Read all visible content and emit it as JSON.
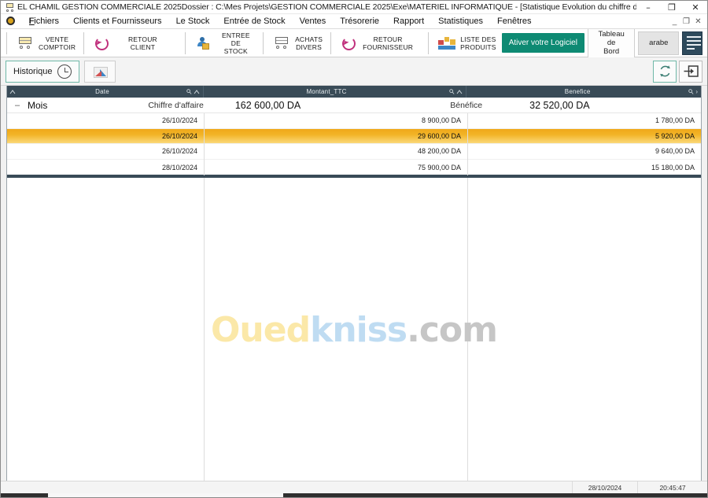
{
  "window": {
    "title": "EL CHAMIL GESTION COMMERCIALE 2025Dossier : C:\\Mes Projets\\GESTION COMMERCIALE 2025\\Exe\\MATERIEL INFORMATIQUE - [Statistique Evolution du chiffre d'Affaire]",
    "minimize": "–",
    "maximize": "❐",
    "close": "✕",
    "mdi_minimize": "_",
    "mdi_restore": "❐",
    "mdi_close": "✕"
  },
  "menubar": {
    "items": [
      {
        "label": "Fichiers",
        "accel": "F"
      },
      {
        "label": "Clients et Fournisseurs",
        "accel": "C"
      },
      {
        "label": "Le Stock",
        "accel": "S"
      },
      {
        "label": "Entrée de Stock",
        "accel": "E"
      },
      {
        "label": "Ventes",
        "accel": "V"
      },
      {
        "label": "Trésorerie",
        "accel": "T"
      },
      {
        "label": "Rapport",
        "accel": "R"
      },
      {
        "label": "Statistiques",
        "accel": "S"
      },
      {
        "label": "Fenêtres",
        "accel": "F"
      }
    ]
  },
  "ribbon": {
    "buttons": [
      {
        "label": "VENTE\nCOMPTOIR",
        "icon": "shopping-cart-icon"
      },
      {
        "label": "RETOUR CLIENT",
        "icon": "return-arrow-icon"
      },
      {
        "label": "ENTREE DE\nSTOCK",
        "icon": "person-box-icon"
      },
      {
        "label": "ACHATS\nDIVERS",
        "icon": "shopping-cart-icon"
      },
      {
        "label": "RETOUR\nFOURNISSEUR",
        "icon": "return-arrow-icon"
      },
      {
        "label": "LISTE DES\nPRODUITS",
        "icon": "product-boxes-icon"
      }
    ],
    "activate_label": "Ativer votre Logiciel",
    "dashboard_label": "Tableau de\nBord",
    "language_label": "arabe",
    "menu_icon": "hamburger-menu-icon"
  },
  "subbar": {
    "historique_label": "Historique",
    "historique_icon": "clock-icon",
    "chart_icon": "chart-icon",
    "refresh_icon": "refresh-icon",
    "exit_icon": "exit-icon"
  },
  "grid": {
    "columns": [
      {
        "key": "date",
        "header": "Date"
      },
      {
        "key": "montant",
        "header": "Montant_TTC"
      },
      {
        "key": "benefice",
        "header": "Benefice"
      }
    ],
    "group_row": {
      "expander": "–",
      "label": "Mois",
      "ca_label": "Chiffre d'affaire",
      "ca_value": "162 600,00 DA",
      "benefice_label": "Bénéfice",
      "benefice_value": "32 520,00 DA"
    },
    "rows": [
      {
        "date": "26/10/2024",
        "montant": "8 900,00 DA",
        "benefice": "1 780,00 DA",
        "selected": false
      },
      {
        "date": "26/10/2024",
        "montant": "29 600,00 DA",
        "benefice": "5 920,00 DA",
        "selected": true
      },
      {
        "date": "26/10/2024",
        "montant": "48 200,00 DA",
        "benefice": "9 640,00 DA",
        "selected": false
      },
      {
        "date": "28/10/2024",
        "montant": "75 900,00 DA",
        "benefice": "15 180,00 DA",
        "selected": false
      }
    ]
  },
  "watermark": {
    "part1": "Oued",
    "part2": "kniss",
    "part3": ".com"
  },
  "statusbar": {
    "date": "28/10/2024",
    "time": "20:45:47"
  },
  "colors": {
    "header_bg": "#394b57",
    "selection": "#f0a81a",
    "accent_teal": "#0e8a73",
    "menu_dark": "#2e4a5c"
  },
  "chart_data": {
    "type": "table",
    "title": "Statistique Evolution du chiffre d'Affaire",
    "columns": [
      "Date",
      "Montant_TTC",
      "Benefice"
    ],
    "rows": [
      [
        "26/10/2024",
        8900,
        1780
      ],
      [
        "26/10/2024",
        29600,
        5920
      ],
      [
        "26/10/2024",
        48200,
        9640
      ],
      [
        "28/10/2024",
        75900,
        15180
      ]
    ],
    "totals": {
      "chiffre_affaire": 162600,
      "benefice": 32520
    },
    "currency": "DA",
    "group_by": "Mois"
  }
}
